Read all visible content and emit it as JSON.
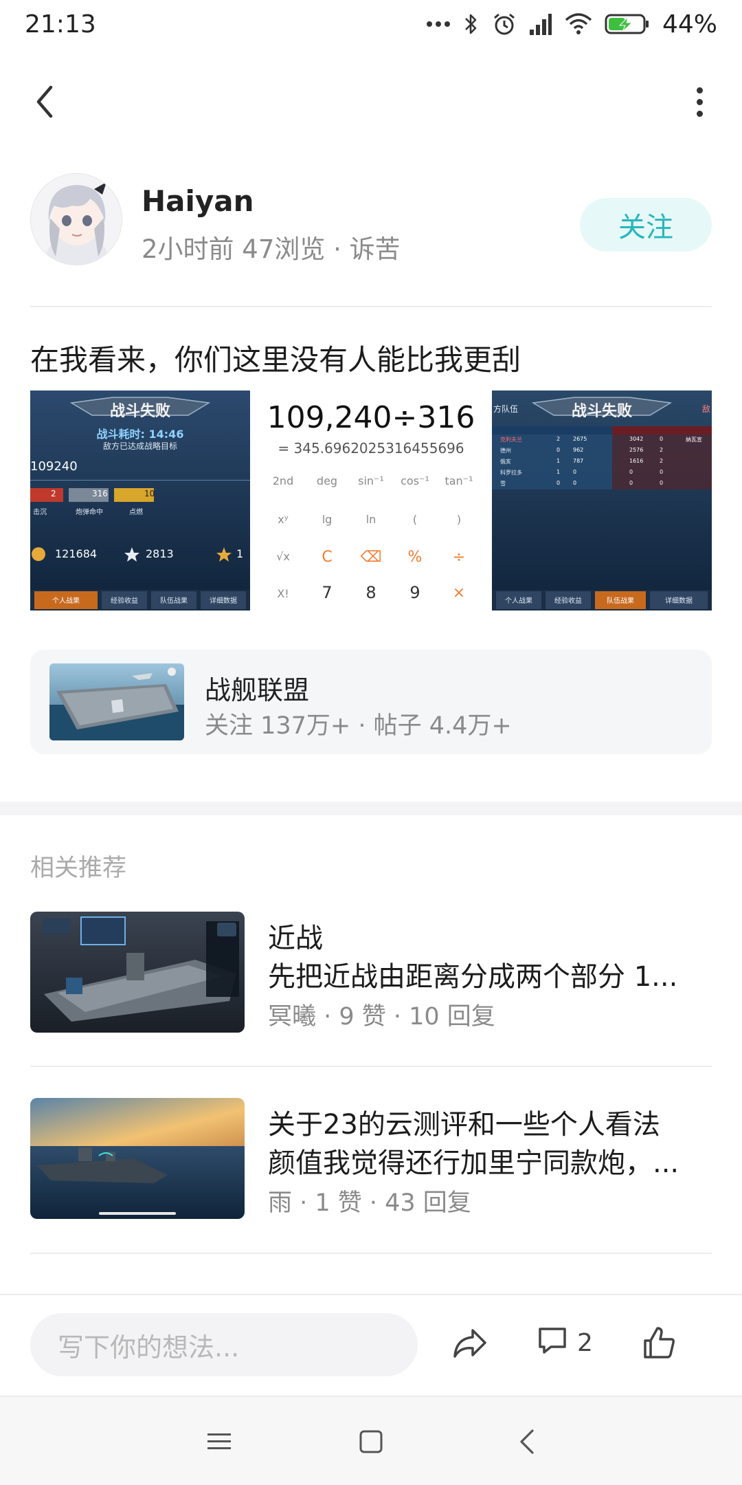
{
  "status_bar": {
    "time": "21:13",
    "battery": "44%",
    "icons": [
      "more-dots-icon",
      "bluetooth-icon",
      "alarm-icon",
      "signal-icon",
      "wifi-icon",
      "battery-charging-icon"
    ]
  },
  "header": {
    "back_icon": "back-arrow-icon",
    "more_icon": "more-vertical-icon"
  },
  "author": {
    "name": "Haiyan",
    "meta": "2小时前 47浏览 · 诉苦",
    "follow_label": "关注"
  },
  "post": {
    "title": "在我看来，你们这里没有人能比我更刮",
    "images": {
      "left": {
        "banner": "战斗失败",
        "time_label": "战斗耗时: 14:46",
        "subtitle": "敌方已达成战略目标",
        "score": "109240",
        "label_sink": "击沉",
        "label_hit": "炮弹命中",
        "label_points": "点燃",
        "badge_1": "2",
        "badge_2": "316",
        "badge_3": "10",
        "coins": "121684",
        "stars": "2813",
        "extra": "1",
        "tabs": [
          "个人战果",
          "经验收益",
          "队伍战果",
          "详细数据"
        ]
      },
      "calculator": {
        "expression": "109,240÷316",
        "result": "= 345.6962025316455696",
        "row1": [
          "2nd",
          "deg",
          "sin⁻¹",
          "cos⁻¹",
          "tan⁻¹"
        ],
        "row2": [
          "xʸ",
          "lg",
          "ln",
          "(",
          ")"
        ],
        "row3": [
          "√x",
          "C",
          "⌫",
          "%",
          "÷"
        ],
        "row4": [
          "X!",
          "7",
          "8",
          "9",
          "×"
        ]
      },
      "right": {
        "banner": "战斗失败",
        "team_label": "方队伍",
        "enemy_label": "敌",
        "rows": [
          {
            "name": "克利夫兰",
            "a": "2",
            "b": "2675",
            "c": "3042",
            "d": "0",
            "e": "纳瓦宣"
          },
          {
            "name": "德州",
            "a": "0",
            "b": "962",
            "c": "2576",
            "d": "2",
            "e": ""
          },
          {
            "name": "俄亥",
            "a": "1",
            "b": "787",
            "c": "1616",
            "d": "2",
            "e": ""
          },
          {
            "name": "科罗拉多",
            "a": "1",
            "b": "0",
            "c": "0",
            "d": "0",
            "e": ""
          },
          {
            "name": "雪",
            "a": "0",
            "b": "0",
            "c": "0",
            "d": "0",
            "e": ""
          }
        ],
        "tabs": [
          "个人战果",
          "经验收益",
          "队伍战果",
          "详细数据"
        ]
      }
    }
  },
  "game_card": {
    "name": "战舰联盟",
    "stats": "关注 137万+ · 帖子 4.4万+"
  },
  "related": {
    "title": "相关推荐",
    "items": [
      {
        "title": "近战",
        "excerpt": "先把近战由距离分成两个部分 1...",
        "meta": "冥曦 · 9 赞 · 10 回复"
      },
      {
        "title": "关于23的云测评和一些个人看法",
        "excerpt": "颜值我觉得还行加里宁同款炮，...",
        "meta": "雨 · 1 赞 · 43 回复"
      }
    ]
  },
  "bottom_bar": {
    "comment_placeholder": "写下你的想法...",
    "comment_count": "2",
    "share_icon": "share-icon",
    "comment_icon": "comment-icon",
    "like_icon": "thumbs-up-icon"
  },
  "nav_bar": {
    "icons": [
      "menu-icon",
      "home-square-icon",
      "back-chevron-icon"
    ]
  },
  "colors": {
    "accent": "#27b7bd",
    "follow_bg": "#e7f8f8",
    "calc_orange": "#f07d32"
  }
}
